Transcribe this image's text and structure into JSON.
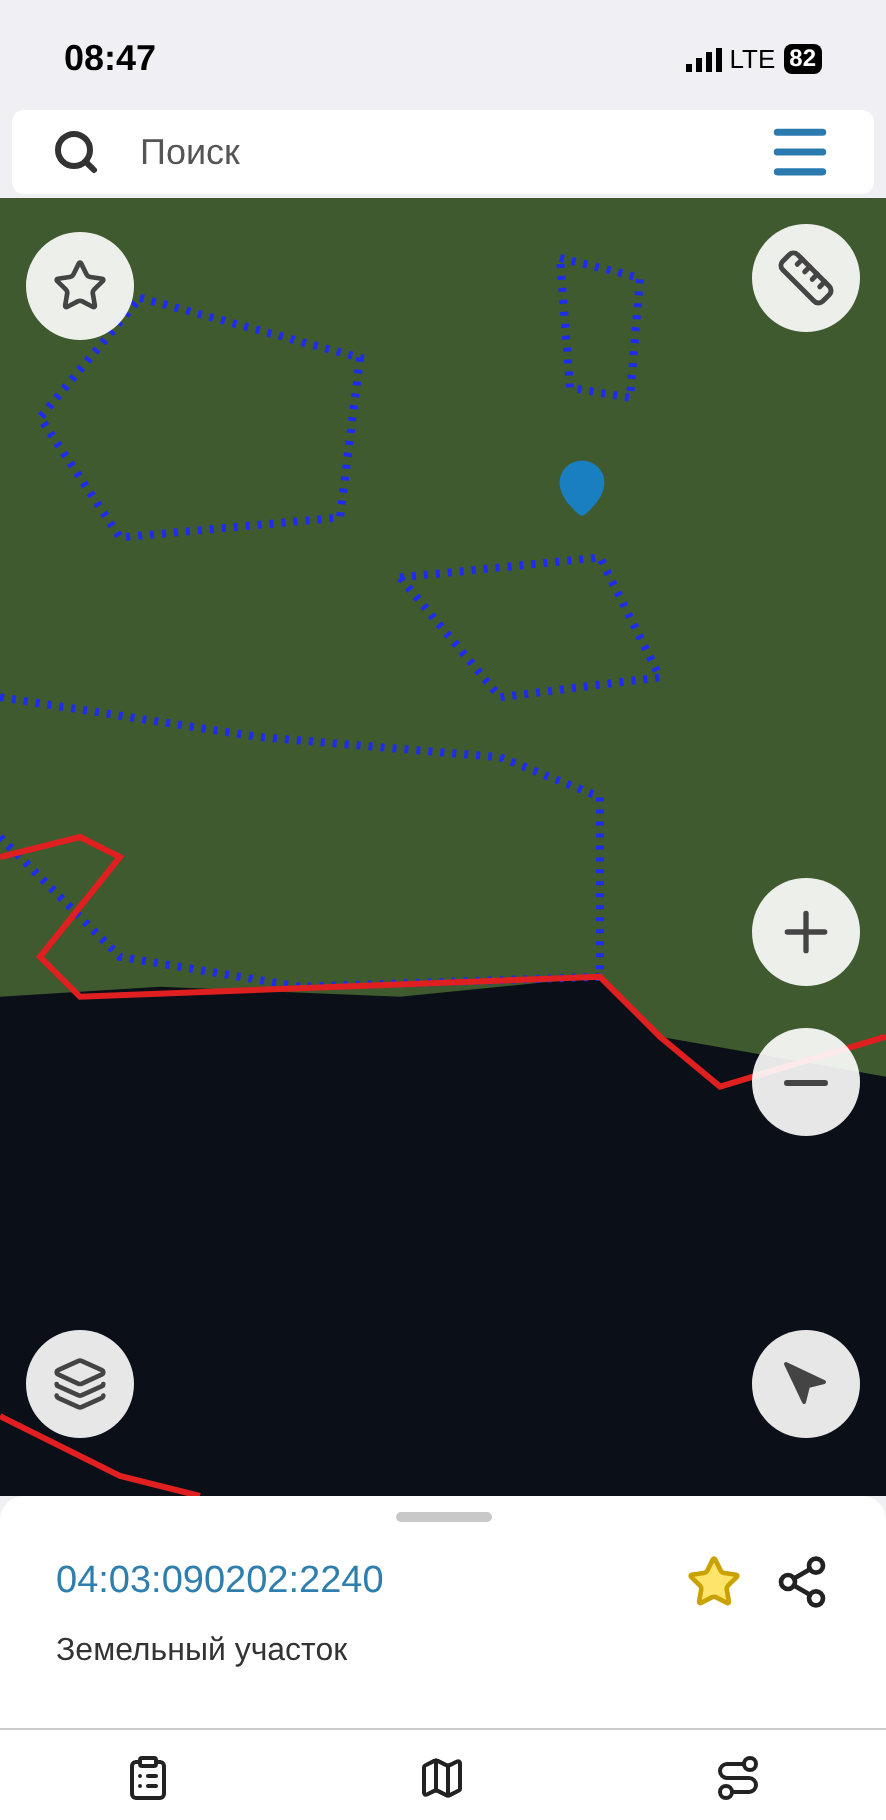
{
  "status_bar": {
    "time": "08:47",
    "network": "LTE",
    "battery": "82"
  },
  "search": {
    "placeholder": "Поиск"
  },
  "parcel": {
    "number": "04:03:090202:2240",
    "type": "Земельный участок",
    "favorite": true
  },
  "tabs": [
    {
      "kind": "clipboard"
    },
    {
      "kind": "map"
    },
    {
      "kind": "route"
    }
  ]
}
